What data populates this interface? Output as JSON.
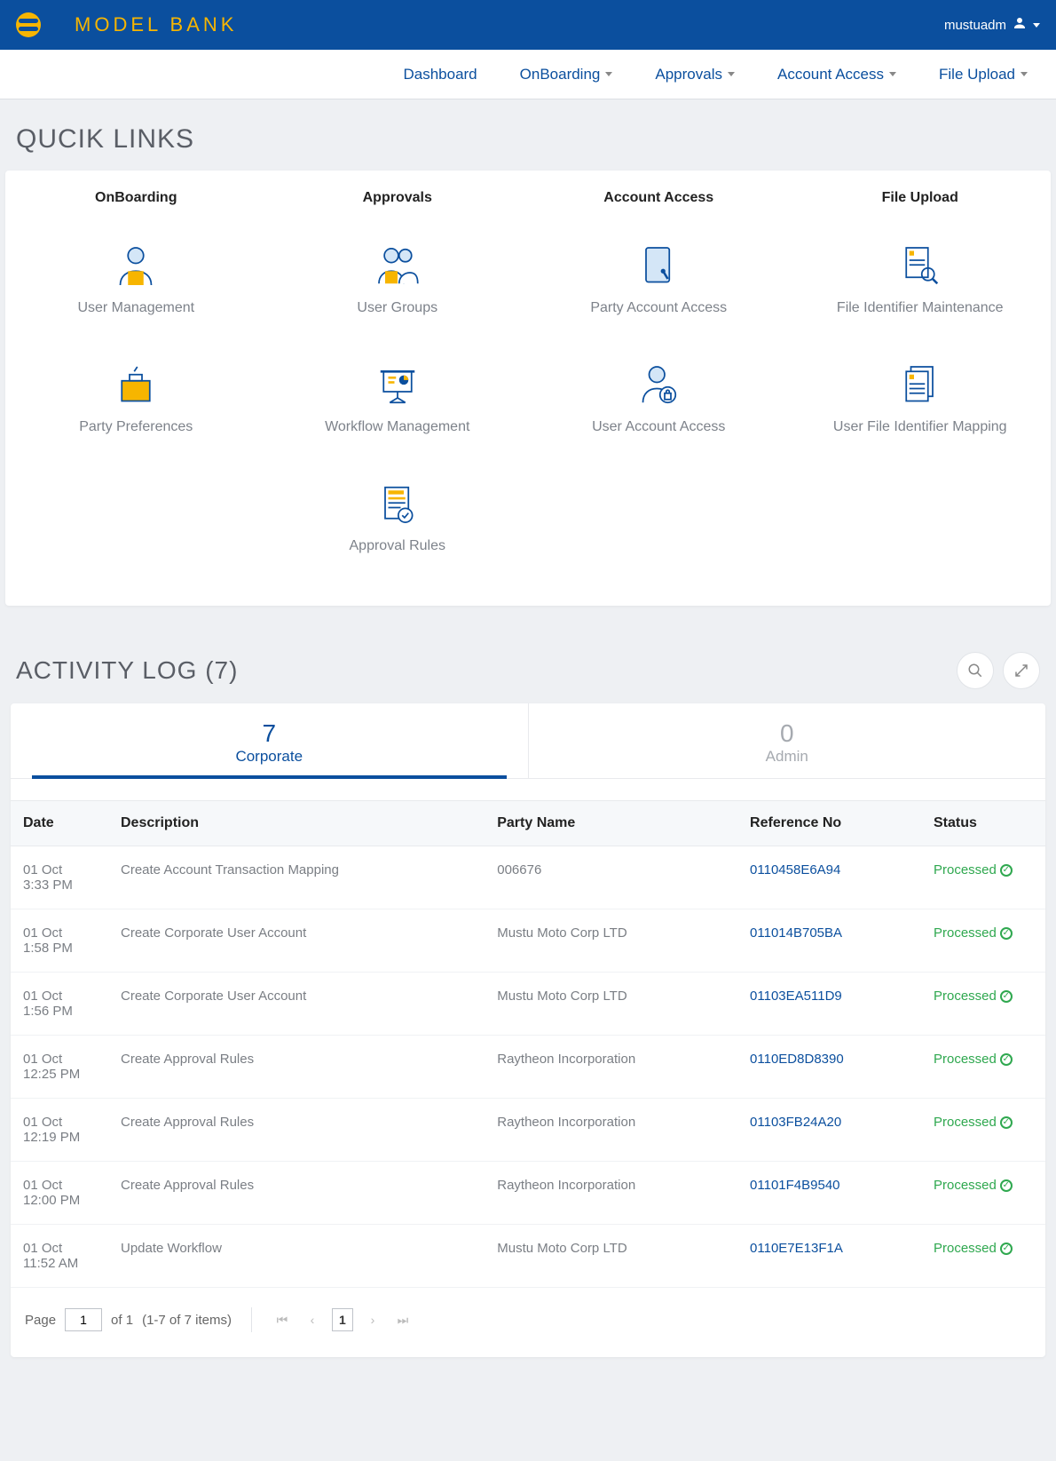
{
  "header": {
    "brand": "MODEL BANK",
    "username": "mustuadm"
  },
  "nav": {
    "items": [
      {
        "label": "Dashboard",
        "hasDropdown": false
      },
      {
        "label": "OnBoarding",
        "hasDropdown": true
      },
      {
        "label": "Approvals",
        "hasDropdown": true
      },
      {
        "label": "Account Access",
        "hasDropdown": true
      },
      {
        "label": "File Upload",
        "hasDropdown": true
      }
    ]
  },
  "quickLinks": {
    "title": "QUCIK LINKS",
    "columns": [
      {
        "head": "OnBoarding"
      },
      {
        "head": "Approvals"
      },
      {
        "head": "Account Access"
      },
      {
        "head": "File Upload"
      }
    ],
    "row1": [
      "User Management",
      "User Groups",
      "Party Account Access",
      "File Identifier Maintenance"
    ],
    "row2": [
      "Party Preferences",
      "Workflow Management",
      "User Account Access",
      "User File Identifier Mapping"
    ],
    "row3": [
      "Approval Rules"
    ]
  },
  "activity": {
    "title": "ACTIVITY LOG (7)",
    "tabs": [
      {
        "count": "7",
        "label": "Corporate",
        "active": true
      },
      {
        "count": "0",
        "label": "Admin",
        "active": false
      }
    ],
    "columns": [
      "Date",
      "Description",
      "Party Name",
      "Reference No",
      "Status"
    ],
    "rows": [
      {
        "date1": "01 Oct",
        "date2": "3:33 PM",
        "desc": "Create Account Transaction Mapping",
        "party": "006676",
        "ref": "0110458E6A94",
        "status": "Processed"
      },
      {
        "date1": "01 Oct",
        "date2": "1:58 PM",
        "desc": "Create Corporate User Account",
        "party": "Mustu Moto Corp LTD",
        "ref": "011014B705BA",
        "status": "Processed"
      },
      {
        "date1": "01 Oct",
        "date2": "1:56 PM",
        "desc": "Create Corporate User Account",
        "party": "Mustu Moto Corp LTD",
        "ref": "01103EA511D9",
        "status": "Processed"
      },
      {
        "date1": "01 Oct",
        "date2": "12:25 PM",
        "desc": "Create Approval Rules",
        "party": "Raytheon Incorporation",
        "ref": "0110ED8D8390",
        "status": "Processed"
      },
      {
        "date1": "01 Oct",
        "date2": "12:19 PM",
        "desc": "Create Approval Rules",
        "party": "Raytheon Incorporation",
        "ref": "01103FB24A20",
        "status": "Processed"
      },
      {
        "date1": "01 Oct",
        "date2": "12:00 PM",
        "desc": "Create Approval Rules",
        "party": "Raytheon Incorporation",
        "ref": "01101F4B9540",
        "status": "Processed"
      },
      {
        "date1": "01 Oct",
        "date2": "11:52 AM",
        "desc": "Update Workflow",
        "party": "Mustu Moto Corp LTD",
        "ref": "0110E7E13F1A",
        "status": "Processed"
      }
    ],
    "pagination": {
      "pageLabel": "Page",
      "currentPage": "1",
      "ofLabel": "of 1",
      "summary": "(1-7 of 7 items)",
      "pageBtn": "1"
    }
  }
}
